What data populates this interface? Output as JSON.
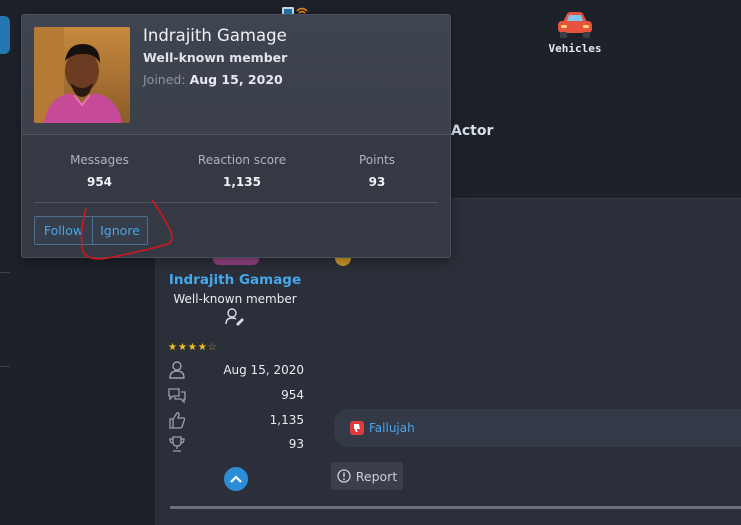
{
  "nav": {
    "vehicles_label": "Vehicles"
  },
  "thread": {
    "title_fragment": "Actor"
  },
  "member_tooltip": {
    "name": "Indrajith Gamage",
    "title": "Well-known member",
    "joined_label": "Joined:",
    "joined_value": "Aug 15, 2020",
    "stats": [
      {
        "label": "Messages",
        "value": "954"
      },
      {
        "label": "Reaction score",
        "value": "1,135"
      },
      {
        "label": "Points",
        "value": "93"
      }
    ],
    "follow_label": "Follow",
    "ignore_label": "Ignore"
  },
  "post": {
    "username": "Indrajith Gamage",
    "user_title": "Well-known member",
    "star_rating": 4.5,
    "stats": {
      "joined": "Aug 15, 2020",
      "messages": "954",
      "reaction_score": "1,135",
      "points": "93"
    },
    "reaction_user": "Fallujah",
    "report_label": "Report"
  },
  "colors": {
    "background": "#1d212a",
    "card": "#2b2f39",
    "tooltip": "#343944",
    "link": "#47a7eb",
    "annotation": "#d0161b",
    "accent": "#2b8dd8"
  },
  "icons": {
    "vehicles": "car-icon",
    "joined": "user-icon",
    "messages": "speech-bubbles-icon",
    "reactions": "thumbs-up-icon",
    "points": "trophy-icon",
    "reaction": "thumbs-down-icon",
    "report": "warning-icon",
    "scroll_top": "chevron-up-icon"
  }
}
